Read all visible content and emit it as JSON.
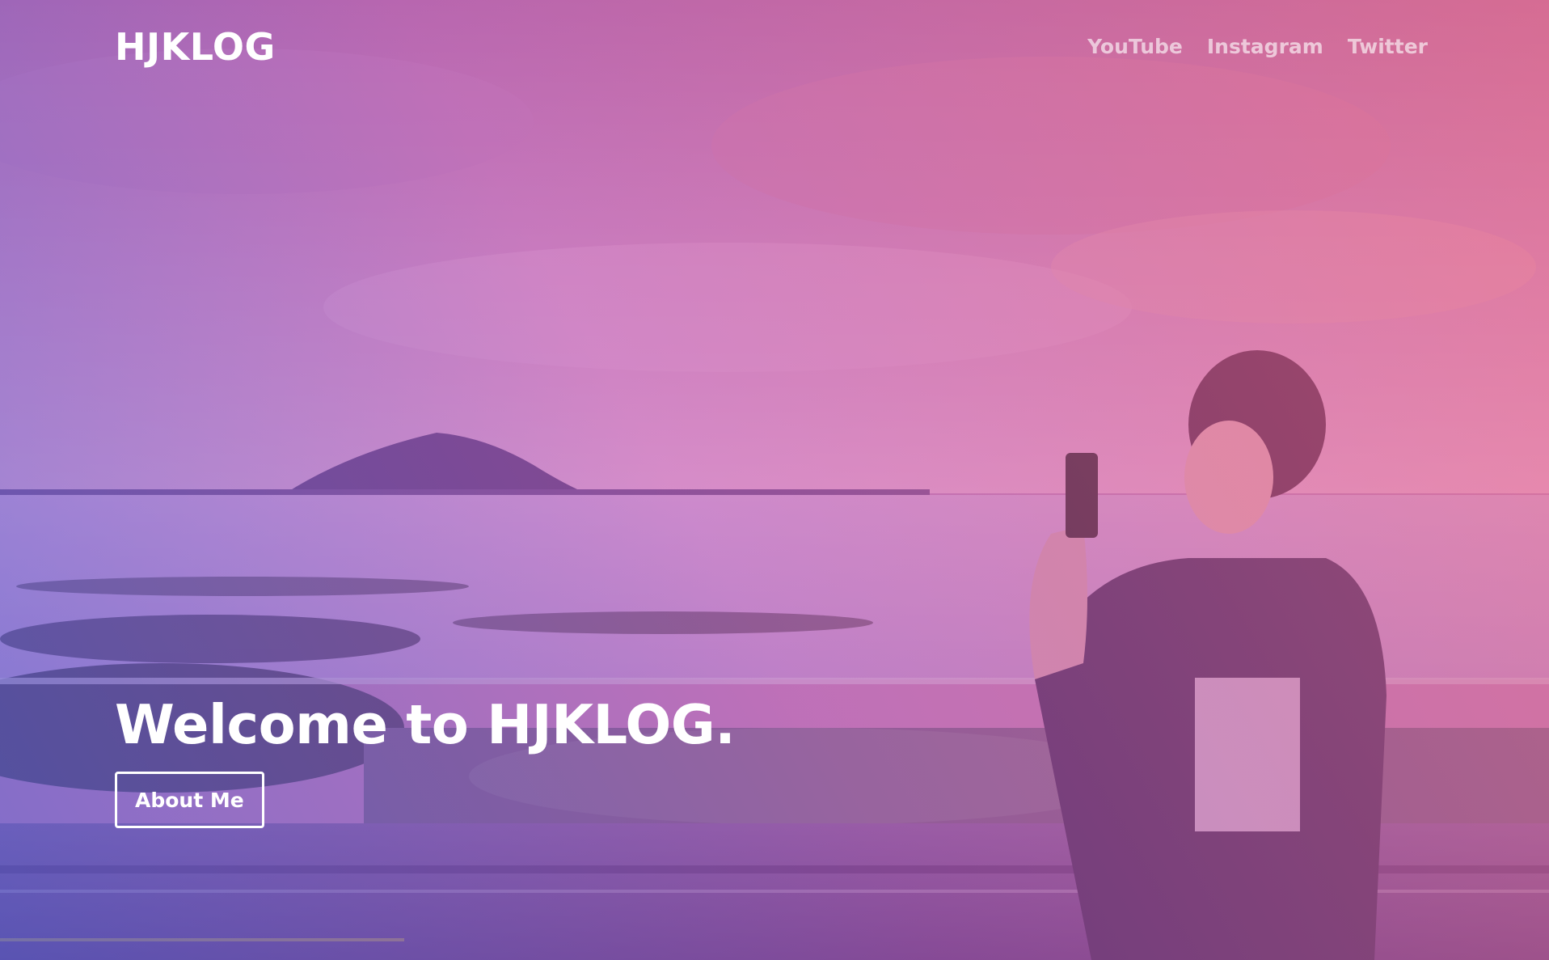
{
  "header": {
    "brand": "HJKLOG",
    "nav": [
      {
        "label": "YouTube"
      },
      {
        "label": "Instagram"
      },
      {
        "label": "Twitter"
      }
    ]
  },
  "hero": {
    "title": "Welcome to HJKLOG.",
    "button_label": "About Me",
    "background": "photo of a person photographing the sea with an island in the distance, with pink-purple gradient overlay"
  },
  "colors": {
    "overlay_start": "#5564dc",
    "overlay_mid": "#d25fbe",
    "overlay_end": "#fa6e82",
    "text": "#ffffff"
  }
}
